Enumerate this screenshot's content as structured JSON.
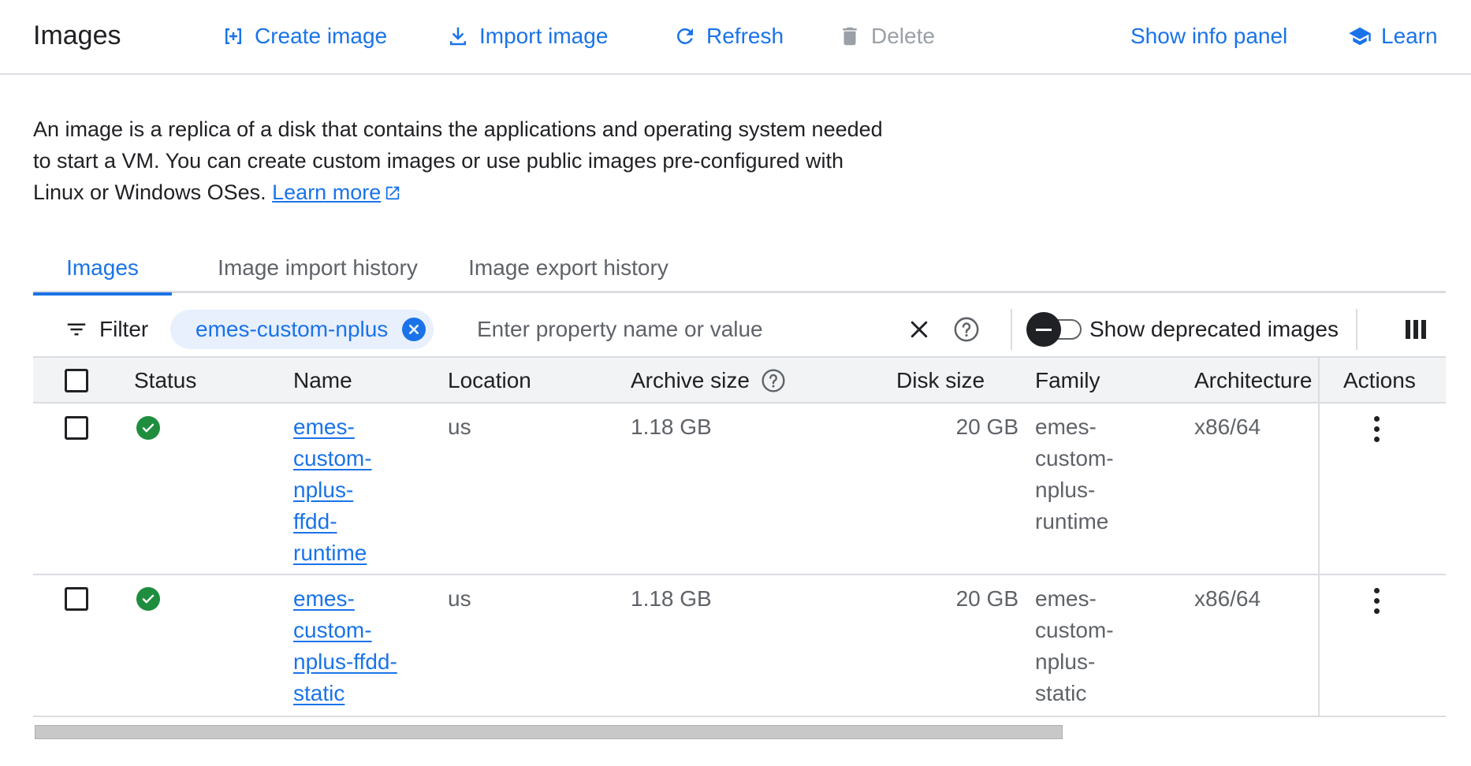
{
  "header": {
    "title": "Images",
    "create_label": "Create image",
    "import_label": "Import image",
    "refresh_label": "Refresh",
    "delete_label": "Delete",
    "info_panel_label": "Show info panel",
    "learn_label": "Learn"
  },
  "intro": {
    "text": "An image is a replica of a disk that contains the applications and operating system needed to start a VM. You can create custom images or use public images pre-configured with Linux or Windows OSes.",
    "link_label": "Learn more"
  },
  "tabs": [
    {
      "label": "Images",
      "active": true
    },
    {
      "label": "Image import history",
      "active": false
    },
    {
      "label": "Image export history",
      "active": false
    }
  ],
  "filter": {
    "label": "Filter",
    "chip": "emes-custom-nplus",
    "placeholder": "Enter property name or value",
    "deprecated_label": "Show deprecated images",
    "deprecated_on": false
  },
  "table": {
    "columns": [
      "Status",
      "Name",
      "Location",
      "Archive size",
      "Disk size",
      "Family",
      "Architecture",
      "Actions"
    ],
    "rows": [
      {
        "name": "emes-custom-nplus-ffdd-runtime",
        "location": "us",
        "archive_size": "1.18 GB",
        "disk_size": "20 GB",
        "family": "emes-custom-nplus-runtime",
        "architecture": "x86/64"
      },
      {
        "name": "emes-custom-nplus-ffdd-static",
        "location": "us",
        "archive_size": "1.18 GB",
        "disk_size": "20 GB",
        "family": "emes-custom-nplus-static",
        "architecture": "x86/64"
      }
    ]
  },
  "colors": {
    "accent": "#1a73e8",
    "success": "#1e8e3e",
    "disabled": "#9aa0a6"
  }
}
